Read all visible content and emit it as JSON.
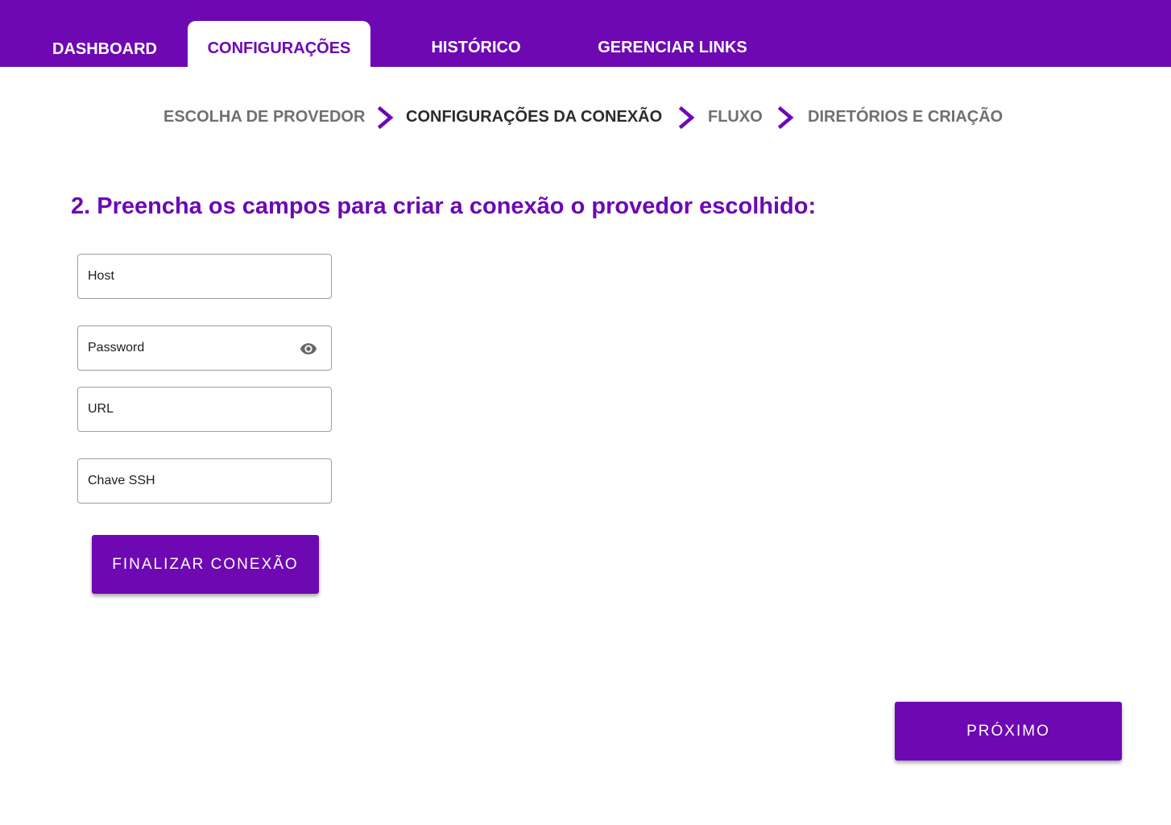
{
  "nav": {
    "tabs": [
      {
        "label": "DASHBOARD",
        "active": false
      },
      {
        "label": "CONFIGURAÇÕES",
        "active": true
      },
      {
        "label": "HISTÓRICO",
        "active": false
      },
      {
        "label": "GERENCIAR LINKS",
        "active": false
      }
    ]
  },
  "stepper": {
    "steps": [
      {
        "label": "ESCOLHA DE PROVEDOR",
        "current": false
      },
      {
        "label": "CONFIGURAÇÕES DA CONEXÃO",
        "current": true
      },
      {
        "label": "FLUXO",
        "current": false
      },
      {
        "label": "DIRETÓRIOS E CRIAÇÃO",
        "current": false
      }
    ],
    "separator_icon": "chevron-right-icon"
  },
  "form": {
    "heading": "2. Preencha os campos para criar a conexão o provedor escolhido:",
    "fields": {
      "host": {
        "placeholder": "Host",
        "value": ""
      },
      "password": {
        "placeholder": "Password",
        "value": "",
        "icon": "eye-icon"
      },
      "url": {
        "placeholder": "URL",
        "value": ""
      },
      "ssh_key": {
        "placeholder": "Chave SSH",
        "value": ""
      }
    },
    "finalize_label": "FINALIZAR CONEXÃO"
  },
  "footer": {
    "next_label": "PRÓXIMO"
  },
  "colors": {
    "brand": "#6e08b3",
    "step_inactive": "#707070",
    "step_current": "#2b2b2b",
    "background": "#ffffff"
  }
}
